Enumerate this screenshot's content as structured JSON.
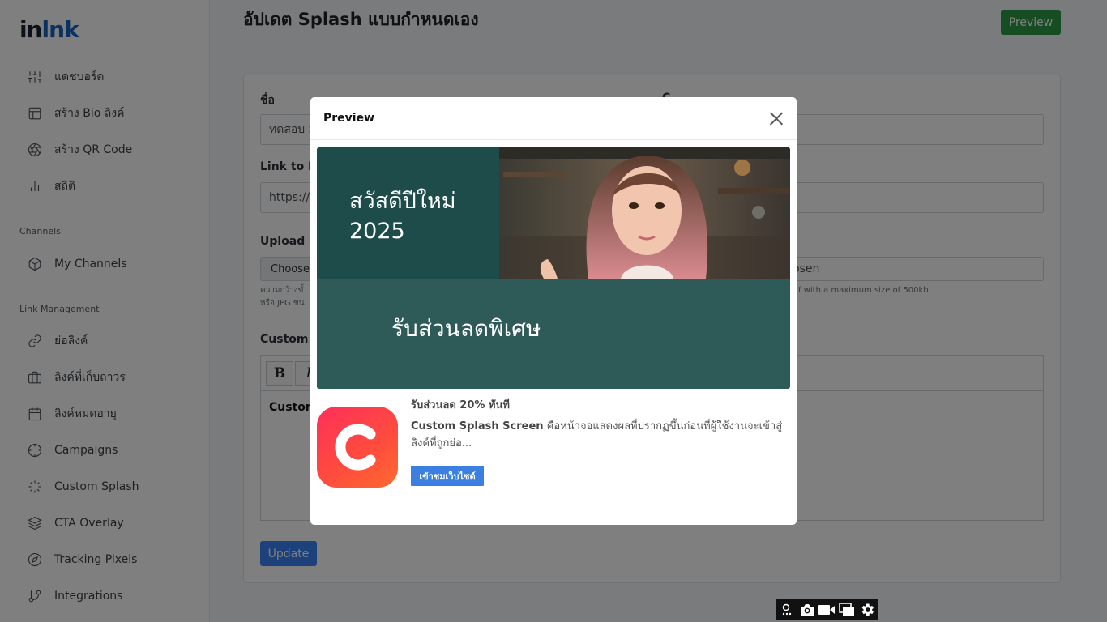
{
  "brand": {
    "part1": "in",
    "part2": "lnk",
    "accent_color": "#1565c0"
  },
  "sidebar": {
    "main_items": [
      {
        "label": "แดชบอร์ด",
        "icon": "sliders-icon"
      },
      {
        "label": "สร้าง Bio ลิงค์",
        "icon": "layout-icon"
      },
      {
        "label": "สร้าง QR Code",
        "icon": "aperture-icon"
      },
      {
        "label": "สถิติ",
        "icon": "bar-chart-icon"
      }
    ],
    "channels_label": "Channels",
    "channel_items": [
      {
        "label": "My Channels",
        "icon": "box-icon"
      }
    ],
    "link_mgmt_label": "Link Management",
    "link_items": [
      {
        "label": "ย่อลิงค์",
        "icon": "link-icon"
      },
      {
        "label": "ลิงค์ที่เก็บถาวร",
        "icon": "briefcase-icon"
      },
      {
        "label": "ลิงค์หมดอายุ",
        "icon": "calendar-icon"
      },
      {
        "label": "Campaigns",
        "icon": "crosshair-icon"
      },
      {
        "label": "Custom Splash",
        "icon": "loader-icon"
      },
      {
        "label": "CTA Overlay",
        "icon": "layers-icon"
      },
      {
        "label": "Tracking Pixels",
        "icon": "compass-icon"
      },
      {
        "label": "Integrations",
        "icon": "git-branch-icon"
      }
    ]
  },
  "page": {
    "title": "อัปเดต Splash แบบกำหนดเอง",
    "preview_label": "Preview",
    "preview_color": "#2e9a45"
  },
  "form": {
    "name_label": "ชื่อ",
    "name_value": "ทดสอบ S",
    "counter_label": "C",
    "link_label": "Link to Pr",
    "link_value": "https://v",
    "upload_label": "Upload Ba",
    "choose_label": "Choose",
    "upload_hint_1": "ความกว้างขั้",
    "upload_hint_2": "หรือ JPG ขน",
    "right_file_value": "osen",
    "right_hint": "f with a maximum size of 500kb.",
    "message_label": "Custom M",
    "bold_btn": "B",
    "italic_btn": "I",
    "editor_text": "Custom",
    "update_label": "Update",
    "update_color": "#3b82f6"
  },
  "modal": {
    "title": "Preview",
    "banner": {
      "greeting_line1": "สวัสดีปีใหม่",
      "greeting_line2": "2025",
      "sale_text": "รับส่วนลดพิเศษ",
      "dark_color": "#1d4c4a",
      "teal_color": "#2e5a58"
    },
    "ad": {
      "headline": "รับส่วนลด 20% ทันที",
      "desc_strong": "Custom Splash Screen",
      "desc_rest": " คือหน้าจอแสดงผลที่ปรากฏขึ้นก่อนที่ผู้ใช้งานจะเข้าสู่ลิงค์ที่ถูกย่อ...",
      "button_label": "เข้าชมเว็บไซต์",
      "icon_letter": "C"
    }
  },
  "floating_toolbar": {
    "icons": [
      "attach-icon",
      "camera-icon",
      "video-icon",
      "windows-icon",
      "gear-icon"
    ]
  }
}
